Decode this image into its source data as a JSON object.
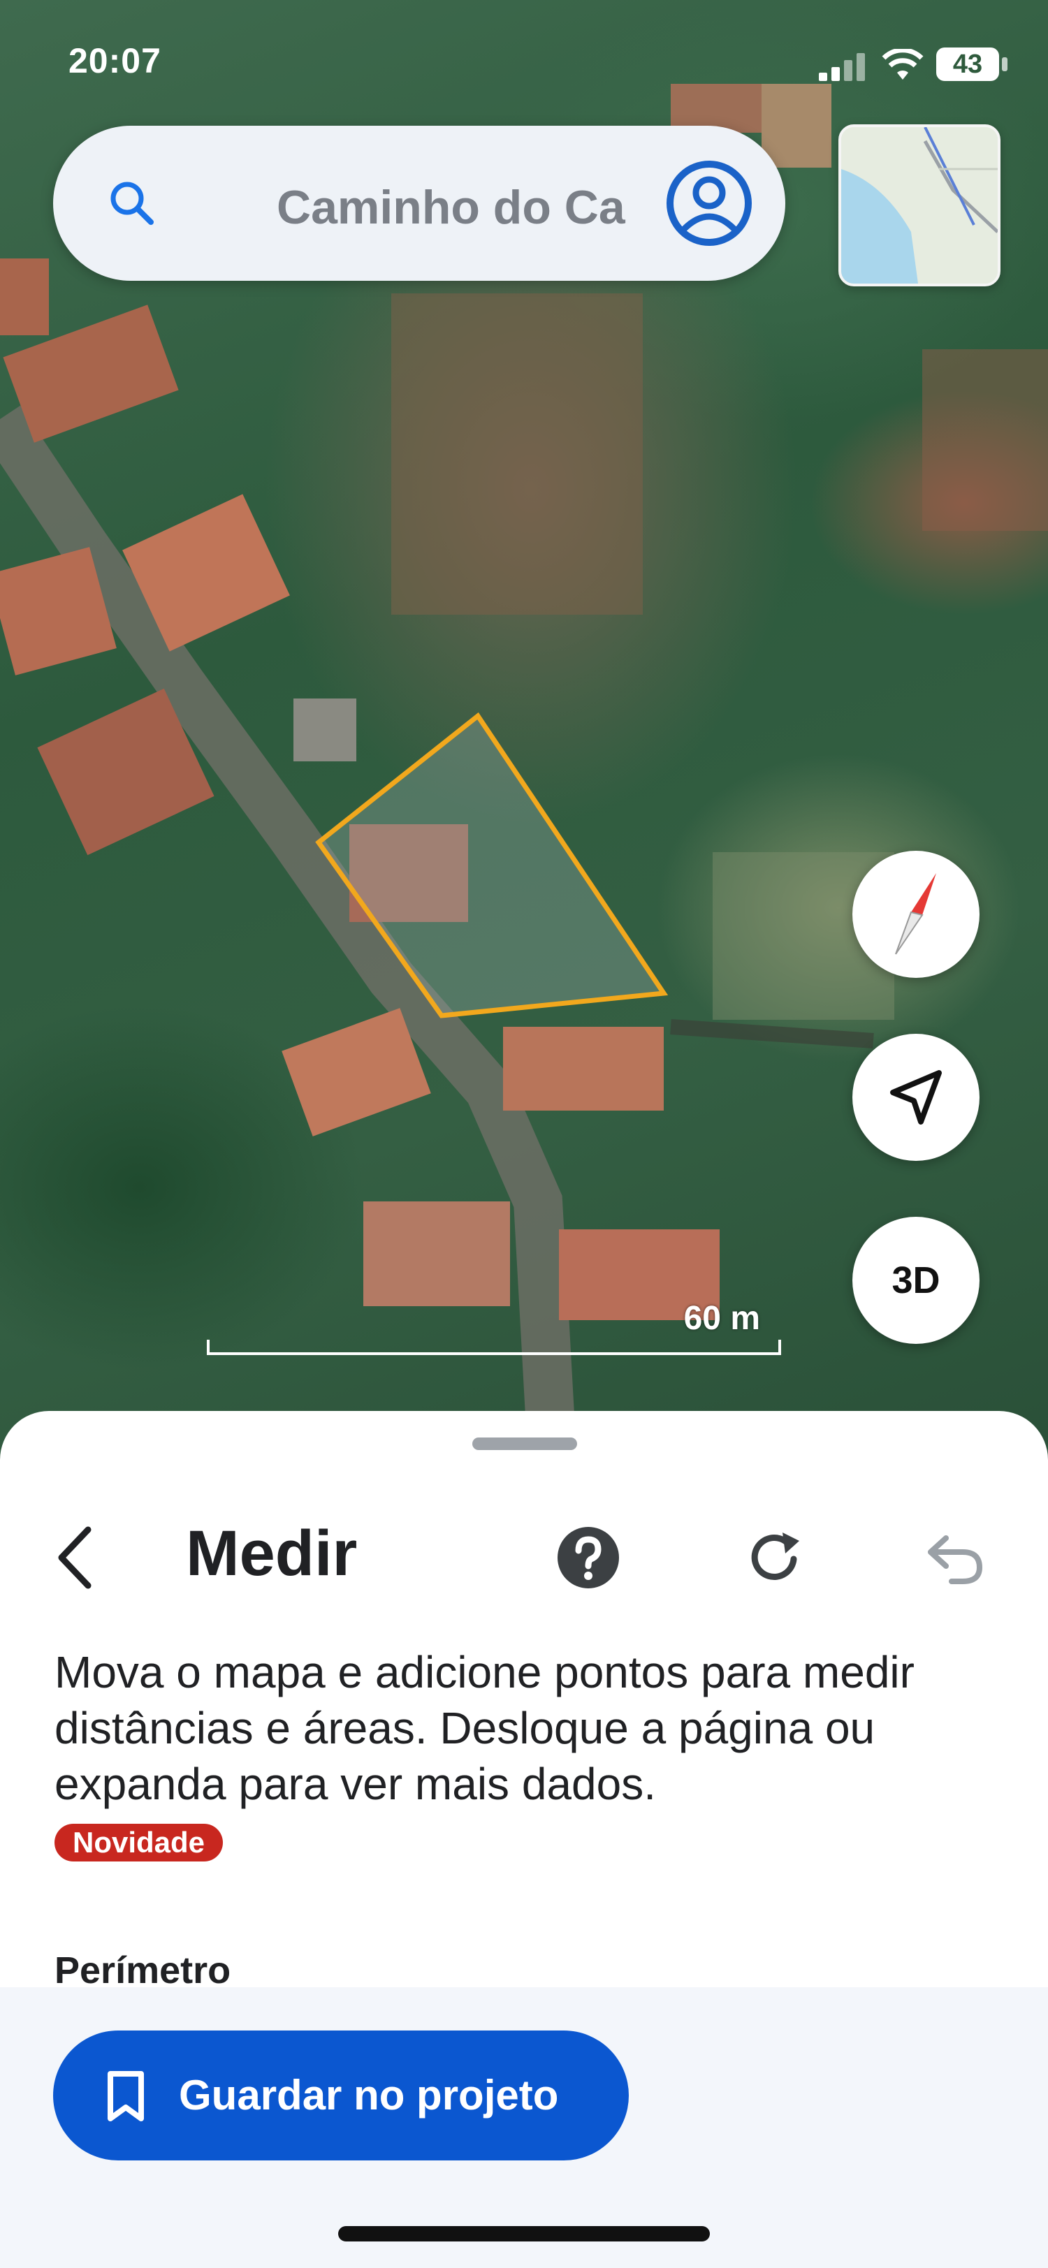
{
  "status_bar": {
    "time": "20:07",
    "battery": "43"
  },
  "search": {
    "query": "Caminho do Ca"
  },
  "map_controls": {
    "three_d_label": "3D"
  },
  "scale": {
    "label": "60 m"
  },
  "sheet": {
    "title": "Medir",
    "description": "Mova o mapa e adicione pontos para medir distâncias e áreas. Desloque a página ou expanda para ver mais dados.",
    "badge": "Novidade",
    "perimeter_label": "Perímetro"
  },
  "footer": {
    "save_button_label": "Guardar no projeto"
  },
  "colors": {
    "accent": "#0b57d0",
    "badge": "#c8271f",
    "measure_outline": "#f2a81d"
  }
}
